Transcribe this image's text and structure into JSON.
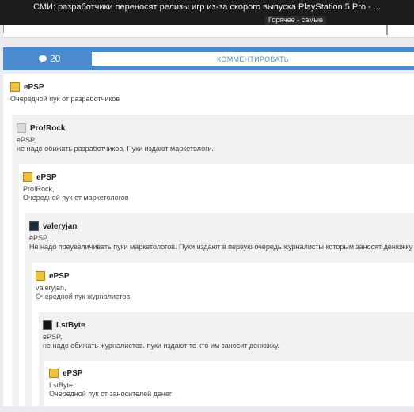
{
  "window": {
    "title": "СМИ: разработчики переносят релизы игр из-за скорого выпуска PlayStation 5 Pro - ...",
    "hot_tag": "Горячее - самые"
  },
  "comment_bar": {
    "count": "20",
    "comment_button": "КОММЕНТИРОВАТЬ"
  },
  "comments": [
    {
      "author": "ePSP",
      "lines": [
        "Очередной пук от разработчиков"
      ],
      "avatar": "yellow-avatar"
    },
    {
      "author": "Pro!Rock",
      "lines": [
        "ePSP,",
        "не надо обижать разработчиков. Пуки издают маркетологи."
      ],
      "avatar": "gray-avatar"
    },
    {
      "author": "ePSP",
      "lines": [
        "Pro!Rock,",
        "Очередной пук от маркетологов"
      ],
      "avatar": "yellow-avatar"
    },
    {
      "author": "valeryjan",
      "lines": [
        "ePSP,",
        "Не надо преувеличивать пуки маркетологов. Пуки издают в первую очередь журналисты которым заносят денюжку"
      ],
      "avatar": "dark-avatar"
    },
    {
      "author": "ePSP",
      "lines": [
        "valeryjan,",
        "Очередной пук журналистов"
      ],
      "avatar": "yellow-avatar"
    },
    {
      "author": "LstByte",
      "lines": [
        "ePSP,",
        "не надо обижать журналистов. пуки издают те кто им заносит денюжку."
      ],
      "avatar": "black-avatar"
    },
    {
      "author": "ePSP",
      "lines": [
        "LstByte,",
        "Очередной пук от заносителей денег"
      ],
      "avatar": "yellow-avatar"
    }
  ],
  "colors": {
    "accent": "#4a8bcf",
    "nested_background": "#f1f1f1",
    "background": "#e9ebee"
  }
}
